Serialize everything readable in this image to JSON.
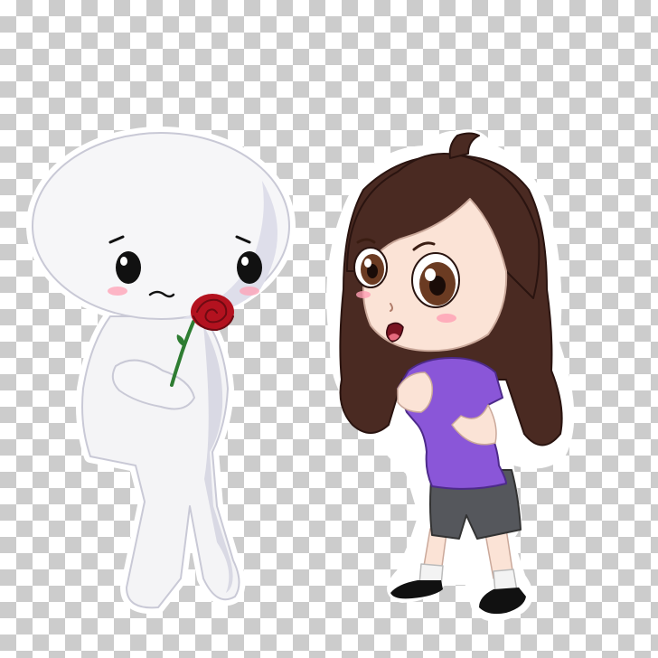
{
  "scene": {
    "background": "transparency-checkerboard",
    "characters": [
      {
        "id": "white-figure",
        "holds": "red-rose",
        "blush": true
      },
      {
        "id": "girl",
        "hair": "long-brown",
        "shirt": "purple",
        "shorts": "gray",
        "shoes": "black"
      }
    ]
  },
  "colors": {
    "checker_light": "#ffffff",
    "checker_dark": "#cccccc",
    "outline": "#ffffff",
    "figure_body": "#f4f4f6",
    "figure_shade": "#d9d9e4",
    "rose": "#b3121f",
    "stem": "#2e7d32",
    "hair": "#4a2a22",
    "skin": "#fbe3d6",
    "shirt": "#8a56d8",
    "shorts": "#55575c",
    "shoes": "#111111",
    "blush": "#ff9fb4",
    "eye_brown": "#6b3b22"
  }
}
